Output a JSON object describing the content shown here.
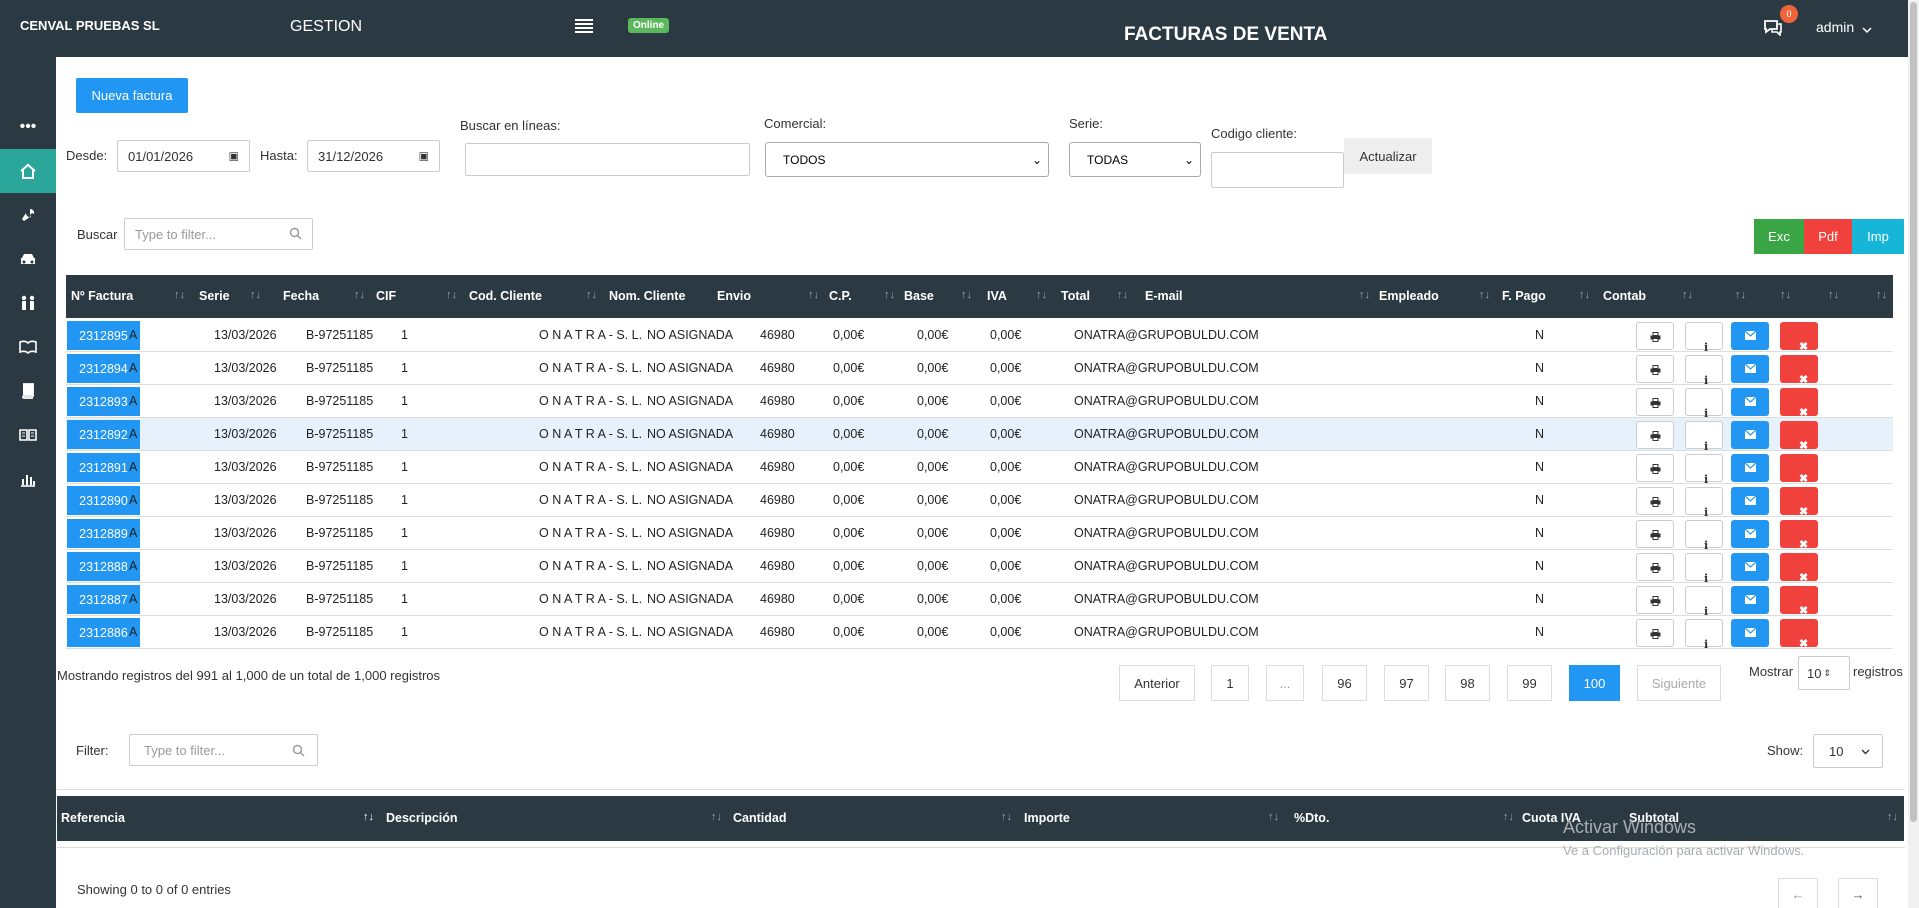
{
  "header": {
    "company": "CENVAL PRUEBAS SL",
    "section": "GESTION",
    "status": "Online",
    "title": "FACTURAS DE VENTA",
    "notifications": "0",
    "user": "admin"
  },
  "toolbar": {
    "new_invoice": "Nueva factura",
    "from_label": "Desde:",
    "from_value": "01/01/2026",
    "to_label": "Hasta:",
    "to_value": "31/12/2026",
    "search_lines_label": "Buscar en líneas:",
    "commercial_label": "Comercial:",
    "commercial_value": "TODOS",
    "series_label": "Serie:",
    "series_value": "TODAS",
    "client_code_label": "Codigo cliente:",
    "update_button": "Actualizar"
  },
  "search": {
    "label": "Buscar",
    "placeholder": "Type to filter..."
  },
  "export": {
    "excel": "Exc",
    "pdf": "Pdf",
    "print": "Imp"
  },
  "table": {
    "columns": [
      "Nº Factura",
      "Serie",
      "Fecha",
      "CIF",
      "Cod. Cliente",
      "Nom. Cliente",
      "Envio",
      "C.P.",
      "Base",
      "IVA",
      "Total",
      "E-mail",
      "Empleado",
      "F. Pago",
      "Contab"
    ],
    "rows": [
      {
        "num": "2312895",
        "serie": "A",
        "fecha": "13/03/2026",
        "cif": "B-97251185",
        "cod": "1",
        "nom": "O N A T R A - S. L.",
        "envio": "NO ASIGNADA",
        "cp": "46980",
        "base": "0,00€",
        "iva": "0,00€",
        "total": "0,00€",
        "email": "ONATRA@GRUPOBULDU.COM",
        "contab": "N"
      },
      {
        "num": "2312894",
        "serie": "A",
        "fecha": "13/03/2026",
        "cif": "B-97251185",
        "cod": "1",
        "nom": "O N A T R A - S. L.",
        "envio": "NO ASIGNADA",
        "cp": "46980",
        "base": "0,00€",
        "iva": "0,00€",
        "total": "0,00€",
        "email": "ONATRA@GRUPOBULDU.COM",
        "contab": "N"
      },
      {
        "num": "2312893",
        "serie": "A",
        "fecha": "13/03/2026",
        "cif": "B-97251185",
        "cod": "1",
        "nom": "O N A T R A - S. L.",
        "envio": "NO ASIGNADA",
        "cp": "46980",
        "base": "0,00€",
        "iva": "0,00€",
        "total": "0,00€",
        "email": "ONATRA@GRUPOBULDU.COM",
        "contab": "N"
      },
      {
        "num": "2312892",
        "serie": "A",
        "fecha": "13/03/2026",
        "cif": "B-97251185",
        "cod": "1",
        "nom": "O N A T R A - S. L.",
        "envio": "NO ASIGNADA",
        "cp": "46980",
        "base": "0,00€",
        "iva": "0,00€",
        "total": "0,00€",
        "email": "ONATRA@GRUPOBULDU.COM",
        "contab": "N"
      },
      {
        "num": "2312891",
        "serie": "A",
        "fecha": "13/03/2026",
        "cif": "B-97251185",
        "cod": "1",
        "nom": "O N A T R A - S. L.",
        "envio": "NO ASIGNADA",
        "cp": "46980",
        "base": "0,00€",
        "iva": "0,00€",
        "total": "0,00€",
        "email": "ONATRA@GRUPOBULDU.COM",
        "contab": "N"
      },
      {
        "num": "2312890",
        "serie": "A",
        "fecha": "13/03/2026",
        "cif": "B-97251185",
        "cod": "1",
        "nom": "O N A T R A - S. L.",
        "envio": "NO ASIGNADA",
        "cp": "46980",
        "base": "0,00€",
        "iva": "0,00€",
        "total": "0,00€",
        "email": "ONATRA@GRUPOBULDU.COM",
        "contab": "N"
      },
      {
        "num": "2312889",
        "serie": "A",
        "fecha": "13/03/2026",
        "cif": "B-97251185",
        "cod": "1",
        "nom": "O N A T R A - S. L.",
        "envio": "NO ASIGNADA",
        "cp": "46980",
        "base": "0,00€",
        "iva": "0,00€",
        "total": "0,00€",
        "email": "ONATRA@GRUPOBULDU.COM",
        "contab": "N"
      },
      {
        "num": "2312888",
        "serie": "A",
        "fecha": "13/03/2026",
        "cif": "B-97251185",
        "cod": "1",
        "nom": "O N A T R A - S. L.",
        "envio": "NO ASIGNADA",
        "cp": "46980",
        "base": "0,00€",
        "iva": "0,00€",
        "total": "0,00€",
        "email": "ONATRA@GRUPOBULDU.COM",
        "contab": "N"
      },
      {
        "num": "2312887",
        "serie": "A",
        "fecha": "13/03/2026",
        "cif": "B-97251185",
        "cod": "1",
        "nom": "O N A T R A - S. L.",
        "envio": "NO ASIGNADA",
        "cp": "46980",
        "base": "0,00€",
        "iva": "0,00€",
        "total": "0,00€",
        "email": "ONATRA@GRUPOBULDU.COM",
        "contab": "N"
      },
      {
        "num": "2312886",
        "serie": "A",
        "fecha": "13/03/2026",
        "cif": "B-97251185",
        "cod": "1",
        "nom": "O N A T R A - S. L.",
        "envio": "NO ASIGNADA",
        "cp": "46980",
        "base": "0,00€",
        "iva": "0,00€",
        "total": "0,00€",
        "email": "ONATRA@GRUPOBULDU.COM",
        "contab": "N"
      }
    ],
    "highlighted_row": 3
  },
  "pagination": {
    "info": "Mostrando registros del 991 al 1,000 de un total de 1,000 registros",
    "prev": "Anterior",
    "pages": [
      "1",
      "...",
      "96",
      "97",
      "98",
      "99",
      "100"
    ],
    "current": "100",
    "next": "Siguiente",
    "show_label": "Mostrar",
    "show_value": "10",
    "records_label": "registros"
  },
  "lines": {
    "filter_label": "Filter:",
    "filter_placeholder": "Type to filter...",
    "show_label": "Show:",
    "show_value": "10",
    "columns": [
      "Referencia",
      "Descripción",
      "Cantidad",
      "Importe",
      "%Dto.",
      "Cuota IVA",
      "Subtotal"
    ],
    "info": "Showing 0 to 0 of 0 entries",
    "prev": "←",
    "next": "→"
  },
  "watermark": {
    "title": "Activar Windows",
    "subtitle": "Ve a Configuración para activar Windows."
  },
  "colors": {
    "header_bg": "#2b3a42",
    "accent_teal": "#2aa69b",
    "primary_blue": "#2196f3",
    "danger_red": "#f0413c",
    "excel_green": "#3aa545",
    "print_cyan": "#17b5d8"
  },
  "icons": {
    "sidebar": [
      "more-icon",
      "home-icon",
      "wrench-icon",
      "car-icon",
      "people-icon",
      "book-open-icon",
      "book-icon",
      "reader-icon",
      "bar-chart-icon"
    ],
    "row_actions": [
      "print-icon",
      "info-icon",
      "mail-icon",
      "delete-icon"
    ]
  }
}
